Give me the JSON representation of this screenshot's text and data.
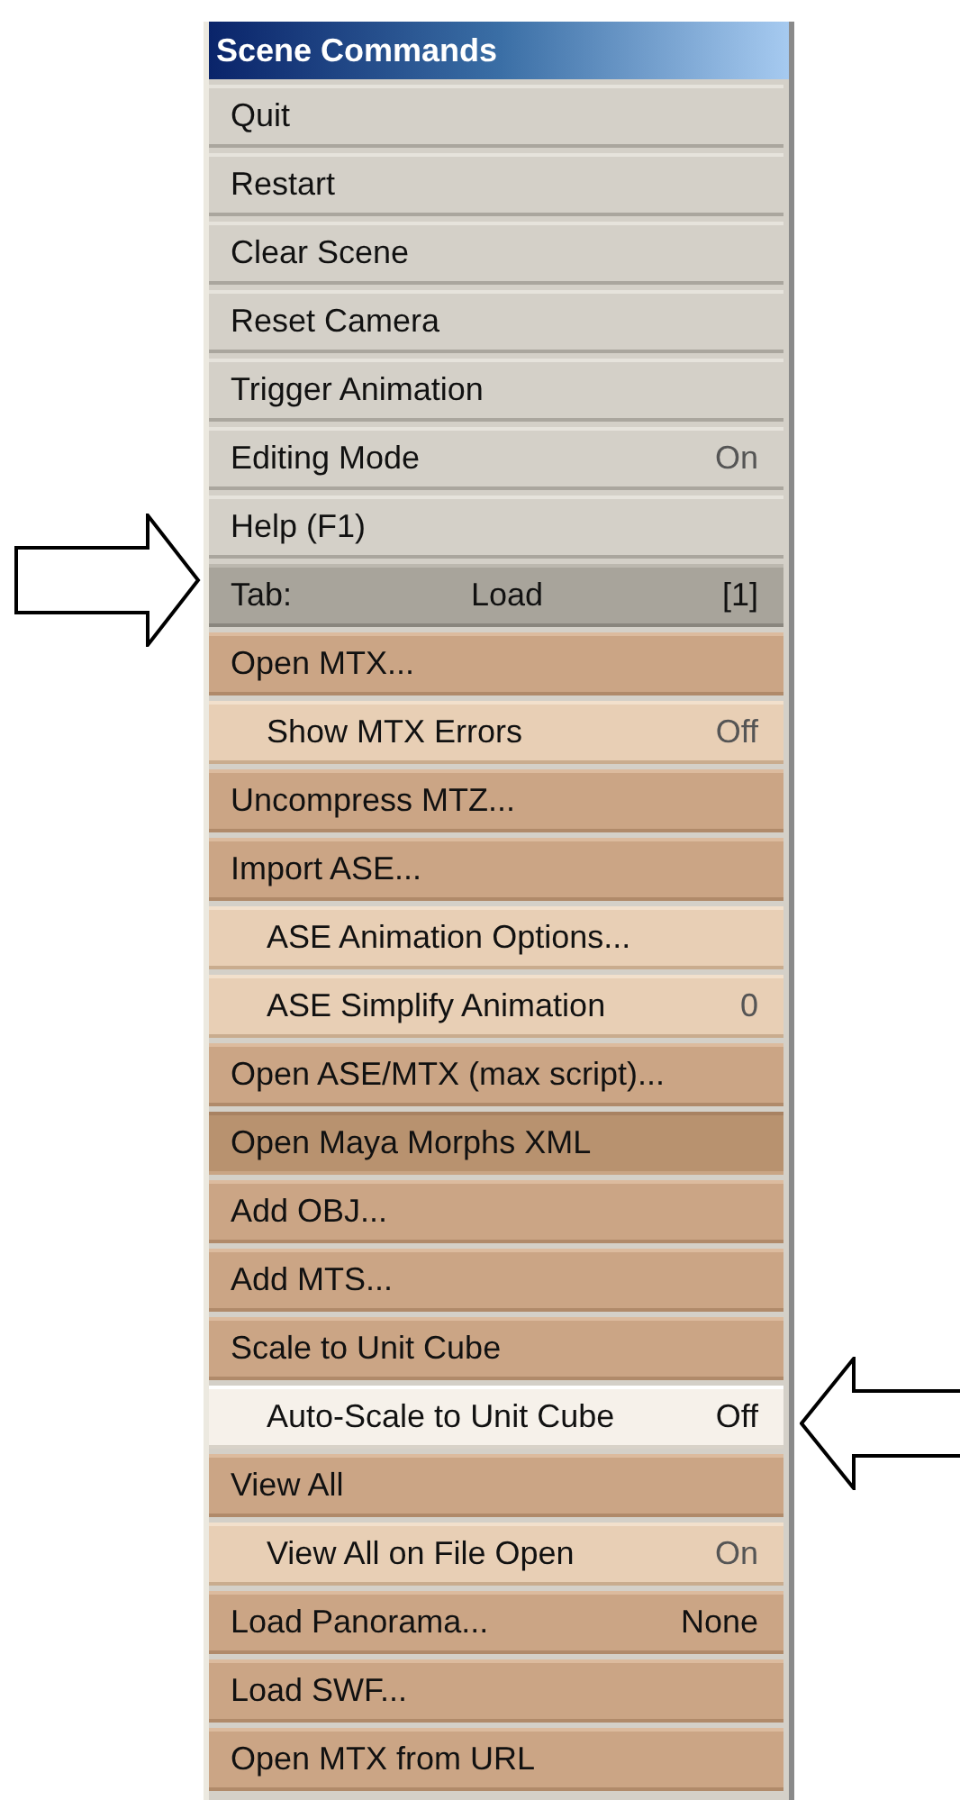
{
  "panel": {
    "title": "Scene Commands",
    "rows": [
      {
        "kind": "command",
        "label": "Quit",
        "highlighted": false,
        "pressed": false
      },
      {
        "kind": "command",
        "label": "Restart",
        "highlighted": false,
        "pressed": false
      },
      {
        "kind": "command",
        "label": "Clear Scene",
        "highlighted": false,
        "pressed": false
      },
      {
        "kind": "command",
        "label": "Reset Camera",
        "highlighted": false,
        "pressed": false
      },
      {
        "kind": "command",
        "label": "Trigger Animation",
        "highlighted": false,
        "pressed": false
      },
      {
        "kind": "command",
        "label": "Editing Mode",
        "value": "On",
        "highlighted": false,
        "pressed": false
      },
      {
        "kind": "command",
        "label": "Help (F1)",
        "highlighted": false,
        "pressed": false
      },
      {
        "kind": "tab",
        "label": "Tab:",
        "value": "Load",
        "index": "[1]",
        "highlighted": false,
        "pressed": false
      },
      {
        "kind": "action",
        "label": "Open MTX...",
        "highlighted": false,
        "pressed": false
      },
      {
        "kind": "option",
        "label": "Show MTX Errors",
        "value": "Off",
        "highlighted": false,
        "pressed": false
      },
      {
        "kind": "action",
        "label": "Uncompress MTZ...",
        "highlighted": false,
        "pressed": false
      },
      {
        "kind": "action",
        "label": "Import ASE...",
        "highlighted": false,
        "pressed": false
      },
      {
        "kind": "option",
        "label": "ASE Animation Options...",
        "highlighted": false,
        "pressed": false
      },
      {
        "kind": "option",
        "label": "ASE Simplify Animation",
        "value": "0",
        "highlighted": false,
        "pressed": false
      },
      {
        "kind": "action",
        "label": "Open ASE/MTX (max script)...",
        "highlighted": false,
        "pressed": false
      },
      {
        "kind": "action",
        "label": "Open Maya Morphs XML",
        "highlighted": false,
        "pressed": true
      },
      {
        "kind": "action",
        "label": "Add OBJ...",
        "highlighted": false,
        "pressed": false
      },
      {
        "kind": "action",
        "label": "Add MTS...",
        "highlighted": false,
        "pressed": false
      },
      {
        "kind": "action",
        "label": "Scale to Unit Cube",
        "highlighted": false,
        "pressed": false
      },
      {
        "kind": "option",
        "label": "Auto-Scale to Unit Cube",
        "value": "Off",
        "highlighted": true,
        "pressed": false
      },
      {
        "kind": "action",
        "label": "View All",
        "highlighted": false,
        "pressed": false
      },
      {
        "kind": "option",
        "label": "View All on File Open",
        "value": "On",
        "highlighted": false,
        "pressed": false
      },
      {
        "kind": "action",
        "label": "Load Panorama...",
        "value": "None",
        "highlighted": false,
        "pressed": false
      },
      {
        "kind": "action",
        "label": "Load SWF...",
        "highlighted": false,
        "pressed": false
      },
      {
        "kind": "action",
        "label": "Open MTX from URL",
        "highlighted": false,
        "pressed": false
      }
    ]
  }
}
